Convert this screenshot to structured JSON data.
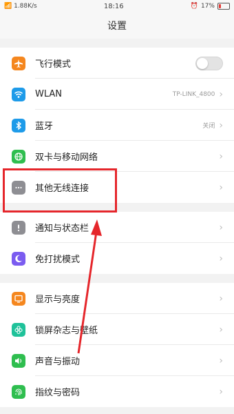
{
  "status": {
    "signal_text": "\t\t.il \t\t 1.88K/s",
    "left_text": "☰il 1.88K/s",
    "time": "18:16",
    "battery": "17%"
  },
  "header": {
    "title": "设置"
  },
  "groups": [
    {
      "items": [
        {
          "name": "airplane",
          "label": "飞行模式",
          "icon": "airplane-icon",
          "color": "#f5871f",
          "control": "toggle",
          "toggle_on": false
        },
        {
          "name": "wlan",
          "label": "WLAN",
          "icon": "wifi-icon",
          "color": "#1e9be9",
          "value": "TP-LINK_4800"
        },
        {
          "name": "bluetooth",
          "label": "蓝牙",
          "icon": "bluetooth-icon",
          "color": "#1e9be9",
          "value": "关闭"
        },
        {
          "name": "dual-sim",
          "label": "双卡与移动网络",
          "icon": "globe-icon",
          "color": "#2fbe4f"
        },
        {
          "name": "other-wireless",
          "label": "其他无线连接",
          "icon": "more-dots-icon",
          "color": "#8e8e93"
        }
      ]
    },
    {
      "items": [
        {
          "name": "notifications",
          "label": "通知与状态栏",
          "icon": "exclamation-icon",
          "color": "#8e8e93"
        },
        {
          "name": "do-not-disturb",
          "label": "免打扰模式",
          "icon": "moon-icon",
          "color": "#7b5cf0"
        }
      ]
    },
    {
      "items": [
        {
          "name": "display",
          "label": "显示与亮度",
          "icon": "display-icon",
          "color": "#f5871f"
        },
        {
          "name": "lockscreen",
          "label": "锁屏杂志与壁纸",
          "icon": "flower-icon",
          "color": "#1fc29a"
        },
        {
          "name": "sound",
          "label": "声音与振动",
          "icon": "speaker-icon",
          "color": "#2fbe4f"
        },
        {
          "name": "fingerprint",
          "label": "指纹与密码",
          "icon": "fingerprint-icon",
          "color": "#2fbe4f"
        }
      ]
    }
  ],
  "annotation": {
    "color": "#e5262b"
  }
}
